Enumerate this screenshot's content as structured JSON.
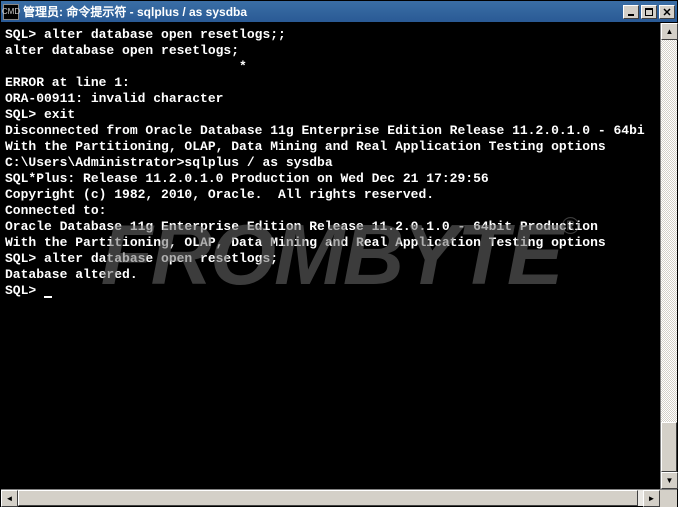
{
  "window": {
    "icon_label": "CMD",
    "title": "管理员: 命令提示符 - sqlplus  / as sysdba"
  },
  "watermark": {
    "text": "FROMBYTE",
    "reg": "®"
  },
  "terminal": {
    "lines": [
      "",
      "SQL> alter database open resetlogs;;",
      "alter database open resetlogs;",
      "                              *",
      "ERROR at line 1:",
      "ORA-00911: invalid character",
      "",
      "",
      "SQL> exit",
      "Disconnected from Oracle Database 11g Enterprise Edition Release 11.2.0.1.0 - 64bi",
      "With the Partitioning, OLAP, Data Mining and Real Application Testing options",
      "",
      "C:\\Users\\Administrator>sqlplus / as sysdba",
      "",
      "SQL*Plus: Release 11.2.0.1.0 Production on Wed Dec 21 17:29:56",
      "",
      "Copyright (c) 1982, 2010, Oracle.  All rights reserved.",
      "",
      "",
      "Connected to:",
      "Oracle Database 11g Enterprise Edition Release 11.2.0.1.0 - 64bit Production",
      "With the Partitioning, OLAP, Data Mining and Real Application Testing options",
      "",
      "SQL> alter database open resetlogs;",
      "",
      "Database altered.",
      "",
      "SQL> "
    ]
  }
}
